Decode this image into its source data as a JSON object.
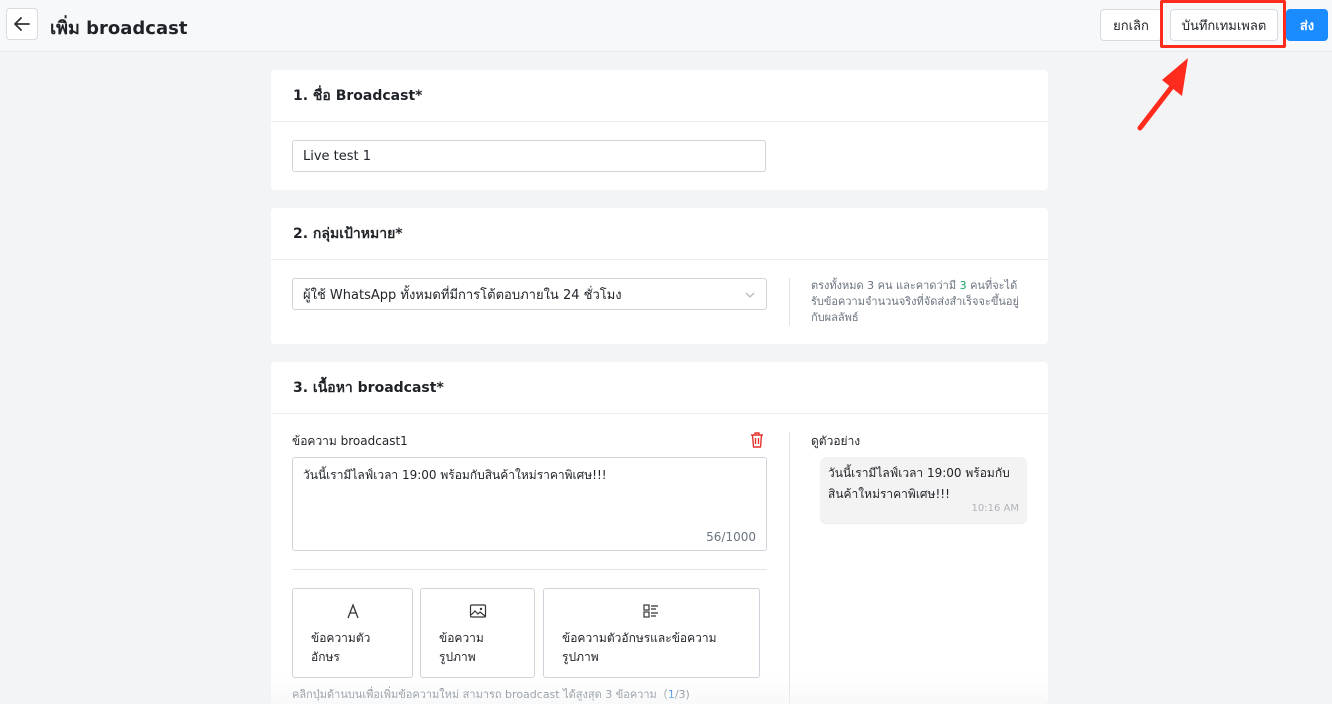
{
  "header": {
    "title": "เพิ่ม broadcast",
    "cancel_label": "ยกเลิก",
    "save_template_label": "บันทึกเทมเพลต",
    "send_label": "ส่ง"
  },
  "section_name": {
    "title": "1. ชื่อ Broadcast*",
    "value": "Live test 1"
  },
  "section_audience": {
    "title": "2. กลุ่มเป้าหมาย*",
    "selected": "ผู้ใช้ WhatsApp ทั้งหมดที่มีการโต้ตอบภายใน 24 ชั่วโมง",
    "note_part1": "ตรงทั้งหมด 3 คน และคาดว่ามี ",
    "note_count": "3",
    "note_part2": " คนที่จะได้รับข้อความจำนวนจริงที่จัดส่งสำเร็จจะขึ้นอยู่กับผลลัพธ์"
  },
  "section_content": {
    "title": "3. เนื้อหา broadcast*",
    "message_label": "ข้อความ broadcast1",
    "message_text": "วันนี้เรามีไลฟ์เวลา 19:00 พร้อมกับสินค้าใหม่ราคาพิเศษ!!!",
    "counter": "56/1000",
    "type_buttons": [
      {
        "icon": "text-icon",
        "label_line1": "ข้อความตัว",
        "label_line2": "อักษร"
      },
      {
        "icon": "image-icon",
        "label_line1": "ข้อความ",
        "label_line2": "รูปภาพ"
      },
      {
        "icon": "text-image-icon",
        "label_line1": "ข้อความตัวอักษรและข้อความ",
        "label_line2": "รูปภาพ"
      }
    ],
    "hint_text": "คลิกปุ่มด้านบนเพื่อเพิ่มข้อความใหม่ สามารถ broadcast ได้สูงสุด 3 ข้อความ（",
    "hint_current": "1",
    "hint_total": "/3)",
    "preview_label": "ดูตัวอย่าง",
    "preview_line1": "วันนี้เรามีไลฟ์เวลา 19:00 พร้อมกับ",
    "preview_line2": "สินค้าใหม่ราคาพิเศษ!!!",
    "preview_time": "10:16 AM"
  },
  "colors": {
    "accent": "#1a8cff",
    "highlight": "#ff2b1c",
    "success": "#1aa260",
    "danger": "#e5322d"
  }
}
